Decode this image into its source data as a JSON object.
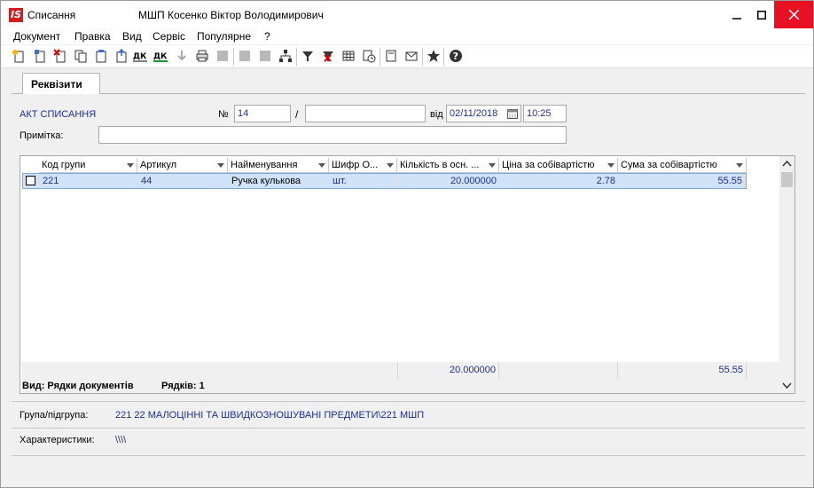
{
  "window": {
    "title": "Списання",
    "subtitle": "МШП Косенко Віктор Володимирович",
    "accent": "#e81123"
  },
  "menu": [
    "Документ",
    "Правка",
    "Вид",
    "Сервіс",
    "Популярне",
    "?"
  ],
  "toolbar_icons": [
    "new-doc-icon",
    "copy-doc-icon",
    "delete-doc-icon",
    "duplicate-icon",
    "paste-icon",
    "export-icon",
    "debit-credit-icon",
    "debit-credit-green-icon",
    "disabled-arrow-icon",
    "print-icon",
    "disabled-square-icon",
    "disabled-square2-icon",
    "disabled-square3-icon",
    "hierarchy-icon",
    "filter-icon",
    "clear-filter-icon",
    "table-icon",
    "history-icon",
    "form-icon",
    "mail-icon",
    "favorite-icon",
    "help-icon"
  ],
  "tab": {
    "label": "Реквізити"
  },
  "header": {
    "doc_type": "АКТ СПИСАННЯ",
    "no_label": "№",
    "number": "14",
    "slash": "/",
    "suffix": "",
    "from_label": "від",
    "date": "02/11/2018",
    "time": "10:25",
    "note_label": "Примітка:",
    "note": ""
  },
  "grid": {
    "columns": [
      "Код групи",
      "Артикул",
      "Найменування",
      "Шифр О...",
      "Кількість в осн. ...",
      "Ціна за собівартістю",
      "Сума за собівартістю"
    ],
    "rows": [
      {
        "code": "221",
        "article": "44",
        "name": "Ручка кулькова",
        "unit": "шт.",
        "qty": "20.000000",
        "price": "2.78",
        "sum": "55.55"
      }
    ],
    "totals": {
      "qty": "20.000000",
      "sum": "55.55"
    },
    "view_label": "Вид: Рядки документів",
    "rows_label": "Рядків: 1"
  },
  "details": {
    "group_label": "Група/підгрупа:",
    "group_value": "221 22 МАЛОЦІННІ ТА ШВИДКОЗНОШУВАНІ ПРЕДМЕТИ\\221 МШП",
    "char_label": "Характеристики:",
    "char_value": "\\\\\\\\"
  }
}
